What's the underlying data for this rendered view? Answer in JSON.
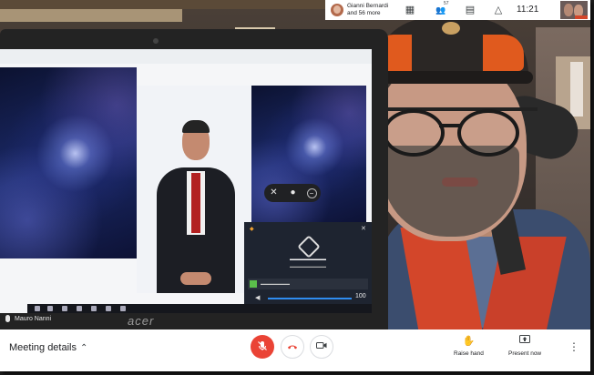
{
  "topbar": {
    "participants_line1": "Gianni Bernardi",
    "participants_line2": "and 56 more",
    "people_count": "57",
    "time": "11:21",
    "icons": [
      "grid-layout-icon",
      "people-icon",
      "chat-icon",
      "activities-icon"
    ]
  },
  "self_view": {
    "name": "Mauro Nanni"
  },
  "laptop": {
    "brand": "acer"
  },
  "controls": {
    "meeting_details_label": "Meeting details",
    "mic_state": "muted",
    "raise_hand_label": "Raise hand",
    "present_now_label": "Present now"
  },
  "inner_screen": {
    "volume_value": "100"
  },
  "colors": {
    "mic_muted": "#ea4335",
    "hangup": "#ea4335",
    "bar_bg": "#ffffff"
  }
}
